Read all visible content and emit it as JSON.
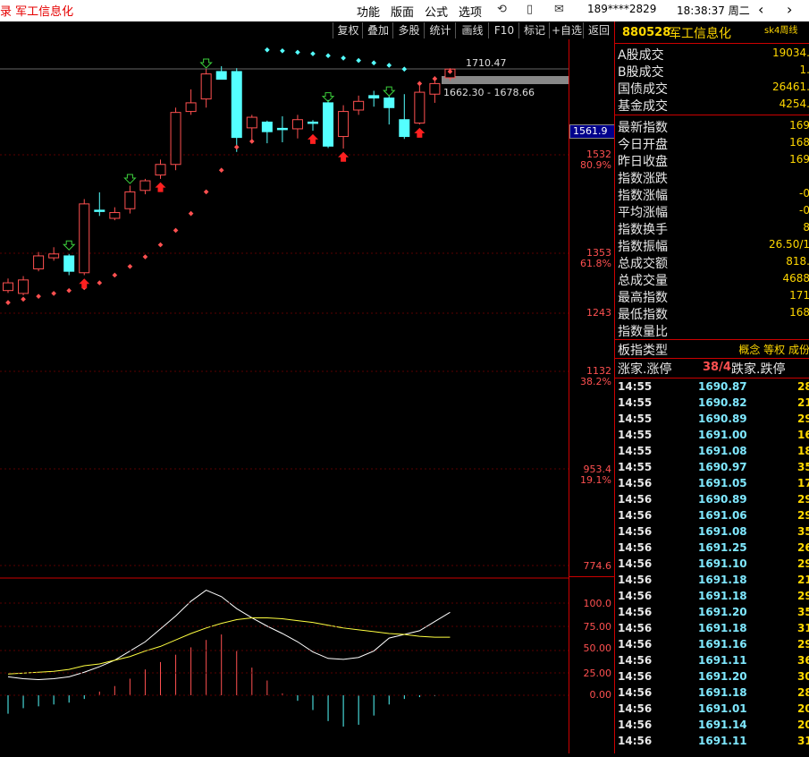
{
  "titlebar": {
    "title": "录  军工信息化",
    "menu": [
      "功能",
      "版面",
      "公式",
      "选项"
    ],
    "user": "189****2829",
    "clock": "18:38:37 周二"
  },
  "toolbar": {
    "buttons": [
      "复权",
      "叠加",
      "多股",
      "统计",
      "画线",
      "F10",
      "标记",
      "+自选",
      "返回"
    ]
  },
  "chart": {
    "high_label": "1710.47",
    "range_label": "1662.30 - 1678.66",
    "current_price": "1561.9",
    "axis_labels": [
      {
        "v": "1532",
        "pct": "80.9%"
      },
      {
        "v": "1353",
        "pct": "61.8%"
      },
      {
        "v": "1243",
        "pct": ""
      },
      {
        "v": "1132",
        "pct": "38.2%"
      },
      {
        "v": "953.4",
        "pct": "19.1%"
      },
      {
        "v": "774.6",
        "pct": ""
      }
    ],
    "macd_axis": [
      "100.0",
      "75.00",
      "50.00",
      "25.00",
      "0.00"
    ]
  },
  "panel": {
    "code": "880528",
    "name": "军工信息化",
    "period": "sk4周线",
    "rows": [
      {
        "label": "A股成交",
        "value": "19034."
      },
      {
        "label": "B股成交",
        "value": "1."
      },
      {
        "label": "国债成交",
        "value": "26461."
      },
      {
        "label": "基金成交",
        "value": "4254."
      },
      {
        "label": "最新指数",
        "value": "169"
      },
      {
        "label": "今日开盘",
        "value": "168"
      },
      {
        "label": "昨日收盘",
        "value": "169"
      },
      {
        "label": "指数涨跌",
        "value": ""
      },
      {
        "label": "指数涨幅",
        "value": "-0"
      },
      {
        "label": "平均涨幅",
        "value": "-0"
      },
      {
        "label": "指数换手",
        "value": "8"
      },
      {
        "label": "指数振幅",
        "value": "26.50/1"
      },
      {
        "label": "总成交额",
        "value": "818."
      },
      {
        "label": "总成交量",
        "value": "4688"
      },
      {
        "label": "最高指数",
        "value": "171"
      },
      {
        "label": "最低指数",
        "value": "168"
      },
      {
        "label": "指数量比",
        "value": ""
      }
    ],
    "type_label": "板指类型",
    "type_value": "概念 等权 成份",
    "updown": {
      "left": "涨家.涨停",
      "count": "38/4",
      "right": "跌家.跌停"
    },
    "ticks": [
      {
        "t": "14:55",
        "p": "1690.87",
        "v": "28"
      },
      {
        "t": "14:55",
        "p": "1690.82",
        "v": "21"
      },
      {
        "t": "14:55",
        "p": "1690.89",
        "v": "29"
      },
      {
        "t": "14:55",
        "p": "1691.00",
        "v": "16"
      },
      {
        "t": "14:55",
        "p": "1691.08",
        "v": "18"
      },
      {
        "t": "14:55",
        "p": "1690.97",
        "v": "35"
      },
      {
        "t": "14:56",
        "p": "1691.05",
        "v": "17"
      },
      {
        "t": "14:56",
        "p": "1690.89",
        "v": "29"
      },
      {
        "t": "14:56",
        "p": "1691.06",
        "v": "29"
      },
      {
        "t": "14:56",
        "p": "1691.08",
        "v": "35"
      },
      {
        "t": "14:56",
        "p": "1691.25",
        "v": "26"
      },
      {
        "t": "14:56",
        "p": "1691.10",
        "v": "29"
      },
      {
        "t": "14:56",
        "p": "1691.18",
        "v": "21"
      },
      {
        "t": "14:56",
        "p": "1691.18",
        "v": "29"
      },
      {
        "t": "14:56",
        "p": "1691.20",
        "v": "35"
      },
      {
        "t": "14:56",
        "p": "1691.18",
        "v": "31"
      },
      {
        "t": "14:56",
        "p": "1691.16",
        "v": "29"
      },
      {
        "t": "14:56",
        "p": "1691.11",
        "v": "36"
      },
      {
        "t": "14:56",
        "p": "1691.20",
        "v": "30"
      },
      {
        "t": "14:56",
        "p": "1691.18",
        "v": "28"
      },
      {
        "t": "14:56",
        "p": "1691.01",
        "v": "20"
      },
      {
        "t": "14:56",
        "p": "1691.14",
        "v": "20"
      },
      {
        "t": "14:56",
        "p": "1691.11",
        "v": "31"
      }
    ]
  },
  "colors": {
    "up": "#ff5050",
    "down": "#54ffff",
    "border": "#c00000",
    "accent": "#ffd700"
  },
  "chart_data": {
    "type": "candlestick",
    "price_axis": {
      "ticks": [
        1532,
        1353,
        1243,
        1132,
        953.4,
        774.6
      ]
    },
    "annotations": [
      "1710.47",
      "1662.30 - 1678.66"
    ],
    "candles": [
      {
        "o": 1250,
        "c": 1266,
        "h": 1275,
        "l": 1245
      },
      {
        "o": 1244,
        "c": 1272,
        "h": 1280,
        "l": 1240
      },
      {
        "o": 1295,
        "c": 1322,
        "h": 1330,
        "l": 1290
      },
      {
        "o": 1318,
        "c": 1326,
        "h": 1340,
        "l": 1312
      },
      {
        "o": 1322,
        "c": 1290,
        "h": 1326,
        "l": 1282
      },
      {
        "o": 1287,
        "c": 1430,
        "h": 1440,
        "l": 1282
      },
      {
        "o": 1417,
        "c": 1415,
        "h": 1454,
        "l": 1405
      },
      {
        "o": 1400,
        "c": 1412,
        "h": 1423,
        "l": 1396
      },
      {
        "o": 1420,
        "c": 1455,
        "h": 1468,
        "l": 1410
      },
      {
        "o": 1458,
        "c": 1478,
        "h": 1482,
        "l": 1450
      },
      {
        "o": 1490,
        "c": 1512,
        "h": 1522,
        "l": 1482
      },
      {
        "o": 1512,
        "c": 1620,
        "h": 1630,
        "l": 1500
      },
      {
        "o": 1622,
        "c": 1640,
        "h": 1668,
        "l": 1615
      },
      {
        "o": 1648,
        "c": 1700,
        "h": 1710,
        "l": 1630
      },
      {
        "o": 1705,
        "c": 1689,
        "h": 1716,
        "l": 1700
      },
      {
        "o": 1705,
        "c": 1568,
        "h": 1712,
        "l": 1538
      },
      {
        "o": 1588,
        "c": 1610,
        "h": 1615,
        "l": 1560
      },
      {
        "o": 1600,
        "c": 1580,
        "h": 1603,
        "l": 1556
      },
      {
        "o": 1587,
        "c": 1585,
        "h": 1612,
        "l": 1558
      },
      {
        "o": 1586,
        "c": 1605,
        "h": 1615,
        "l": 1566
      },
      {
        "o": 1600,
        "c": 1598,
        "h": 1604,
        "l": 1582
      },
      {
        "o": 1640,
        "c": 1550,
        "h": 1646,
        "l": 1546
      },
      {
        "o": 1570,
        "c": 1622,
        "h": 1635,
        "l": 1545
      },
      {
        "o": 1625,
        "c": 1643,
        "h": 1655,
        "l": 1615
      },
      {
        "o": 1655,
        "c": 1650,
        "h": 1665,
        "l": 1632
      },
      {
        "o": 1650,
        "c": 1630,
        "h": 1655,
        "l": 1595
      },
      {
        "o": 1605,
        "c": 1570,
        "h": 1658,
        "l": 1565
      },
      {
        "o": 1598,
        "c": 1662,
        "h": 1680,
        "l": 1595
      },
      {
        "o": 1658,
        "c": 1680,
        "h": 1695,
        "l": 1640
      },
      {
        "o": 1692,
        "c": 1710,
        "h": 1712,
        "l": 1686
      }
    ],
    "sar": [
      1225,
      1232,
      1238,
      1244,
      1250,
      1256,
      1266,
      1282,
      1300,
      1320,
      1345,
      1375,
      1410,
      1455,
      1500,
      1548,
      1560,
      1750,
      1748,
      1745,
      1742,
      1738,
      1733,
      1728,
      1723,
      1718,
      1710,
      1680,
      1690,
      1705
    ],
    "macd_fast": [
      20,
      18,
      17,
      18,
      20,
      25,
      31,
      38,
      48,
      58,
      72,
      86,
      102,
      114,
      107,
      94,
      84,
      75,
      67,
      58,
      47,
      40,
      39,
      41,
      48,
      62,
      66,
      70,
      80,
      90
    ],
    "macd_slow": [
      23,
      24,
      25,
      26,
      28,
      32,
      34,
      38,
      42,
      48,
      53,
      60,
      67,
      73,
      78,
      82,
      84,
      84,
      83,
      81,
      79,
      76,
      73,
      71,
      69,
      67,
      66,
      64,
      63,
      63
    ],
    "macd_hist": [
      -20,
      -14,
      -12,
      -10,
      -8,
      -4,
      4,
      10,
      18,
      28,
      36,
      44,
      52,
      60,
      66,
      48,
      30,
      16,
      2,
      -6,
      -16,
      -28,
      -34,
      -32,
      -22,
      -10,
      -4,
      -2,
      -1,
      0
    ]
  }
}
